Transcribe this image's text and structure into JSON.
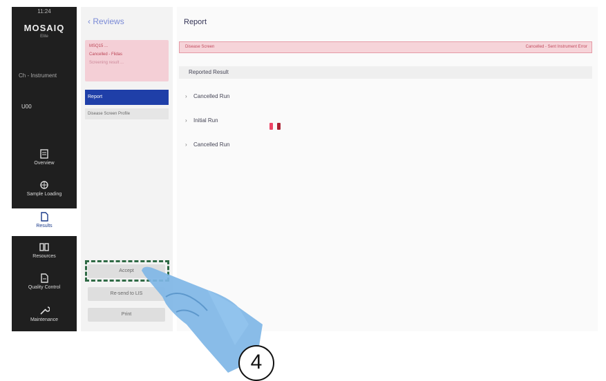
{
  "nav": {
    "clock": "11:24",
    "logo": "MOSAIQ",
    "logo_sub": "Elite",
    "instrument": "Ch - Instrument",
    "user": "U00",
    "items": [
      {
        "label": "Overview",
        "icon": "overview-icon"
      },
      {
        "label": "Sample Loading",
        "icon": "sample-loading-icon"
      },
      {
        "label": "Results",
        "icon": "results-icon"
      },
      {
        "label": "Resources",
        "icon": "resources-icon"
      },
      {
        "label": "Quality Control",
        "icon": "quality-control-icon"
      },
      {
        "label": "Maintenance",
        "icon": "maintenance-icon"
      }
    ]
  },
  "subnav": {
    "back_label": "Reviews",
    "card": {
      "line1": "MSQ15 ...",
      "line2": "Cancelled - Flidas",
      "line3": "Screening result ..."
    },
    "report_label": "Report",
    "screen_label": "Disease Screen Profile",
    "buttons": {
      "first": "Accept",
      "second": "Re-send to LIS",
      "third": "Print"
    }
  },
  "main": {
    "title": "Report",
    "banner_left": "Disease Screen",
    "banner_right": "Cancelled - Sent Instrument Error",
    "reported_result": "Reported Result",
    "runs": [
      "Cancelled Run",
      "Initial Run",
      "Cancelled Run"
    ]
  },
  "step_number": "4"
}
